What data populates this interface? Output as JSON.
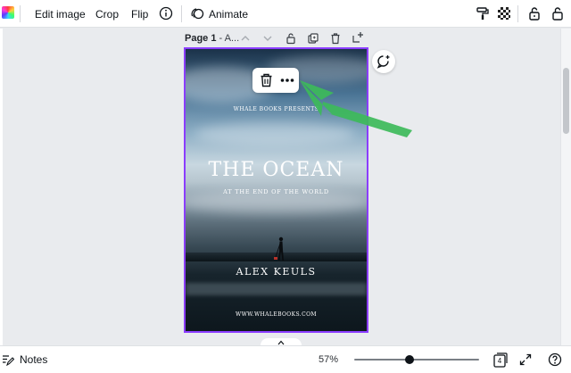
{
  "toolbar": {
    "edit_image": "Edit image",
    "crop": "Crop",
    "flip": "Flip",
    "animate": "Animate",
    "icons": [
      "color-swatch",
      "info-icon",
      "animate-icon",
      "paint-roller-icon",
      "transparency-icon",
      "unlock-icon",
      "lock-icon"
    ]
  },
  "page_header": {
    "page_label": "Page 1",
    "separator_title": " - A..."
  },
  "cover": {
    "publisher": "WHALE BOOKS PRESENTS",
    "title": "THE OCEAN",
    "subtitle": "AT THE END OF THE WORLD",
    "author": "ALEX KEULS",
    "website": "WWW.WHALEBOOKS.COM"
  },
  "context_menu": {
    "icons": [
      "trash-icon",
      "more-icon"
    ]
  },
  "bottombar": {
    "notes": "Notes",
    "zoom": "57%",
    "zoom_level": 0.57,
    "page_count": "4"
  },
  "colors": {
    "selection": "#8b3dff",
    "arrow": "#3dba5a",
    "toolbar_bg": "#ffffff",
    "workspace_bg": "#e9ebee"
  }
}
